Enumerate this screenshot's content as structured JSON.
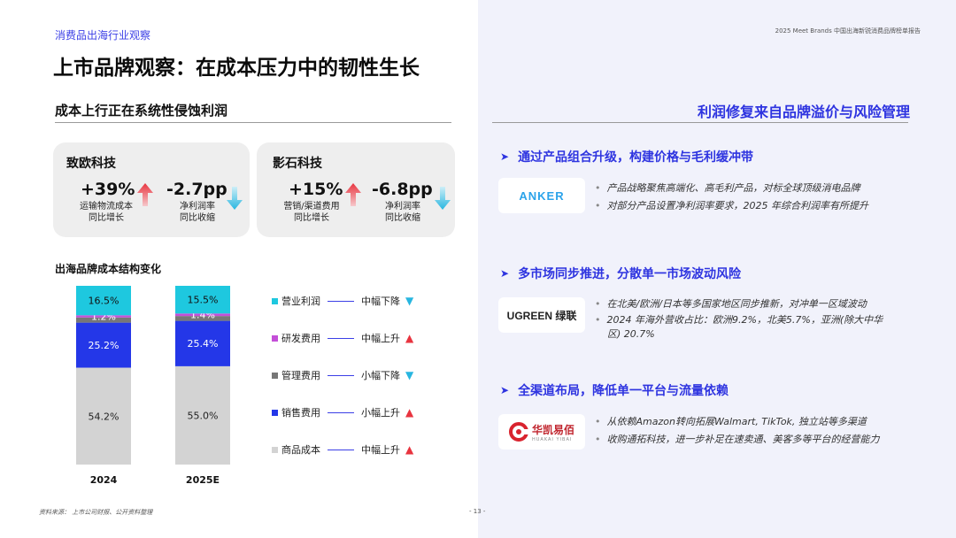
{
  "header": {
    "section_tag": "消费品出海行业观察",
    "report_name": "2025 Meet Brands 中国出海新锐消费品牌榜单报告",
    "title": "上市品牌观察：在成本压力中的韧性生长"
  },
  "left": {
    "subtitle": "成本上行正在系统性侵蚀利润",
    "cards": [
      {
        "name": "致欧科技",
        "metric1": {
          "value": "+39%",
          "label_line1": "运输物流成本",
          "label_line2": "同比增长",
          "direction": "up"
        },
        "metric2": {
          "value": "-2.7pp",
          "label_line1": "净利润率",
          "label_line2": "同比收缩",
          "direction": "down"
        }
      },
      {
        "name": "影石科技",
        "metric1": {
          "value": "+15%",
          "label_line1": "营销/渠道费用",
          "label_line2": "同比增长",
          "direction": "up"
        },
        "metric2": {
          "value": "-6.8pp",
          "label_line1": "净利润率",
          "label_line2": "同比收缩",
          "direction": "down"
        }
      }
    ]
  },
  "chart_data": {
    "type": "bar",
    "stacked": true,
    "percent": true,
    "title": "出海品牌成本结构变化",
    "categories": [
      "2024",
      "2025E"
    ],
    "series": [
      {
        "name": "商品成本",
        "values": [
          54.2,
          55.0
        ],
        "labels": [
          "54.2%",
          "55.0%"
        ],
        "color": "#d3d3d3",
        "trend": "中幅上升",
        "trend_dir": "up"
      },
      {
        "name": "销售费用",
        "values": [
          25.2,
          25.4
        ],
        "labels": [
          "25.2%",
          "25.4%"
        ],
        "color": "#2437e8",
        "trend": "小幅上升",
        "trend_dir": "up"
      },
      {
        "name": "管理费用",
        "values": [
          2.9,
          2.7
        ],
        "labels": [
          "",
          ""
        ],
        "color": "#777777",
        "trend": "小幅下降",
        "trend_dir": "down"
      },
      {
        "name": "研发费用",
        "values": [
          1.2,
          1.4
        ],
        "labels": [
          "1.2%",
          "1.4%"
        ],
        "color": "#c44fd8",
        "trend": "中幅上升",
        "trend_dir": "up"
      },
      {
        "name": "营业利润",
        "values": [
          16.5,
          15.5
        ],
        "labels": [
          "16.5%",
          "15.5%"
        ],
        "color": "#1ec8df",
        "trend": "中幅下降",
        "trend_dir": "down"
      }
    ],
    "legend_order": [
      "营业利润",
      "研发费用",
      "管理费用",
      "销售费用",
      "商品成本"
    ]
  },
  "right": {
    "subtitle": "利润修复来自品牌溢价与风险管理",
    "sections": [
      {
        "heading": "通过产品组合升级，构建价格与毛利缓冲带",
        "logo": "ANKER",
        "bullets": [
          "产品战略聚焦高端化、高毛利产品，对标全球顶级消电品牌",
          "对部分产品设置净利润率要求，2025 年综合利润率有所提升"
        ]
      },
      {
        "heading": "多市场同步推进，分散单一市场波动风险",
        "logo": "UGREEN 绿联",
        "bullets": [
          "在北美/欧洲/日本等多国家地区同步推新，对冲单一区域波动",
          "2024 年海外营收占比：欧洲9.2%，北美5.7%，亚洲(除大中华",
          "区) 20.7%"
        ]
      },
      {
        "heading": "全渠道布局，降低单一平台与流量依赖",
        "logo": "华凯易佰",
        "logo_sub": "HUAKAI YIBAI",
        "bullets": [
          "从依赖Amazon转向拓展Walmart, TikTok, 独立站等多渠道",
          "收购通拓科技，进一步补足在速卖通、美客多等平台的经营能力"
        ]
      }
    ]
  },
  "footer": {
    "source": "资料来源： 上市公司财报、公开资料整理",
    "page": "- 13 -"
  }
}
